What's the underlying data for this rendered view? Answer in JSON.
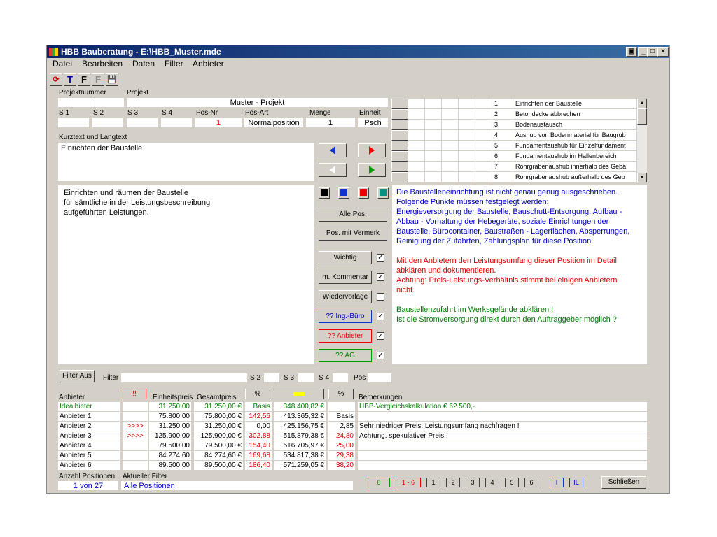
{
  "window": {
    "title": "HBB Bauberatung - E:\\HBB_Muster.mde"
  },
  "menu": [
    "Datei",
    "Bearbeiten",
    "Daten",
    "Filter",
    "Anbieter"
  ],
  "toolbar": {
    "t_label": "T",
    "f_label": "F",
    "f2_label": "F"
  },
  "form": {
    "projektnummer_label": "Projektnummer",
    "projekt_label": "Projekt",
    "projekt_value": "Muster - Projekt",
    "s1_label": "S 1",
    "s2_label": "S 2",
    "s3_label": "S 3",
    "s4_label": "S 4",
    "posnr_label": "Pos-Nr",
    "posnr_value": "1",
    "posart_label": "Pos-Art",
    "posart_value": "Normalposition",
    "menge_label": "Menge",
    "menge_value": "1",
    "einheit_label": "Einheit",
    "einheit_value": "Psch",
    "kurztext_label": "Kurztext und Langtext",
    "kurztext_value": "Einrichten der Baustelle",
    "langtext": [
      "Einrichten und räumen der Baustelle",
      "für sämtliche in der Leistungsbeschreibung",
      "aufgeführten Leistungen."
    ]
  },
  "positions": [
    {
      "nr": "1",
      "text": "Einrichten der Baustelle"
    },
    {
      "nr": "2",
      "text": "Betondecke abbrechen"
    },
    {
      "nr": "3",
      "text": "Bodenaustausch"
    },
    {
      "nr": "4",
      "text": "Aushub von Bodenmaterial für Baugrub"
    },
    {
      "nr": "5",
      "text": "Fundamentaushub für Einzelfundament"
    },
    {
      "nr": "6",
      "text": "Fundamentaushub im Hallenbereich"
    },
    {
      "nr": "7",
      "text": "Rohrgrabenaushub innerhalb des Gebä"
    },
    {
      "nr": "8",
      "text": "Rohrgrabenaushub außerhalb des Geb"
    }
  ],
  "buttons": {
    "alle_pos": "Alle Pos.",
    "pos_vermerk": "Pos. mit Vermerk",
    "wichtig": "Wichtig",
    "kommentar": "m. Kommentar",
    "wiedervorlage": "Wiedervorlage",
    "ing_buero": "?? Ing.-Büro",
    "anbieter": "?? Anbieter",
    "ag": "?? AG",
    "filter_aus": "Filter Aus",
    "schliessen": "Schließen"
  },
  "notes": {
    "blue": [
      "Die Baustelleneinrichtung ist nicht genau genug ausgeschrieben.",
      "Folgende Punkte müssen festgelegt werden:",
      "Energieversorgung der Baustelle, Bauschutt-Entsorgung, Aufbau -",
      "Abbau - Vorhaltung der Hebegeräte, soziale Einrichtungen der",
      "Baustelle, Bürocontainer, Baustraßen - Lagerflächen, Absperrungen,",
      "Reinigung der Zufahrten, Zahlungsplan für diese Position."
    ],
    "red": [
      "Mit den Anbietern den Leistungsumfang dieser Position im Detail",
      "abklären und dokumentieren.",
      "Achtung: Preis-Leistungs-Verhältnis stimmt bei einigen Anbietern",
      "nicht."
    ],
    "green": [
      "Baustellenzufahrt im Werksgelände abklären !",
      "Ist die Stromversorgung direkt durch den Auftraggeber möglich ?"
    ]
  },
  "filter": {
    "label": "Filter",
    "s2": "S 2",
    "s3": "S 3",
    "s4": "S 4",
    "pos": "Pos"
  },
  "table": {
    "headers": {
      "anbieter": "Anbieter",
      "excl": "!!",
      "einheitspreis": "Einheitspreis",
      "gesamtpreis": "Gesamtpreis",
      "pct1": "%",
      "pct2": "%",
      "bemerkungen": "Bemerkungen"
    },
    "rows": [
      {
        "name": "Idealbieter",
        "flag": "",
        "ep": "31.250,00",
        "gp": "31.250,00 €",
        "pct": "Basis",
        "sum": "348.400,82 €",
        "pct2": "",
        "note": "HBB-Vergleichskalkulation   € 62.500,-"
      },
      {
        "name": "Anbieter 1",
        "flag": "",
        "ep": "75.800,00",
        "gp": "75.800,00 €",
        "pct": "142,56",
        "sum": "413.365,32 €",
        "pct2": "Basis",
        "note": ""
      },
      {
        "name": "Anbieter 2",
        "flag": ">>>>",
        "ep": "31.250,00",
        "gp": "31.250,00 €",
        "pct": "0,00",
        "sum": "425.156,75 €",
        "pct2": "2,85",
        "note": "Sehr niedriger Preis. Leistungsumfang nachfragen !"
      },
      {
        "name": "Anbieter 3",
        "flag": ">>>>",
        "ep": "125.900,00",
        "gp": "125.900,00 €",
        "pct": "302,88",
        "sum": "515.879,38 €",
        "pct2": "24,80",
        "note": "Achtung, spekulativer Preis !"
      },
      {
        "name": "Anbieter 4",
        "flag": "",
        "ep": "79.500,00",
        "gp": "79.500,00 €",
        "pct": "154,40",
        "sum": "516.705,97 €",
        "pct2": "25,00",
        "note": ""
      },
      {
        "name": "Anbieter 5",
        "flag": "",
        "ep": "84.274,60",
        "gp": "84.274,60 €",
        "pct": "169,68",
        "sum": "534.817,38 €",
        "pct2": "29,38",
        "note": ""
      },
      {
        "name": "Anbieter 6",
        "flag": "",
        "ep": "89.500,00",
        "gp": "89.500,00 €",
        "pct": "186,40",
        "sum": "571.259,05 €",
        "pct2": "38,20",
        "note": ""
      }
    ]
  },
  "footer": {
    "anzahl_label": "Anzahl Positionen",
    "anzahl_value": "1 von 27",
    "filter_label": "Aktueller Filter",
    "filter_value": "Alle Positionen"
  },
  "pager": [
    "0",
    "1 - 6",
    "1",
    "2",
    "3",
    "4",
    "5",
    "6",
    "I",
    "IL"
  ]
}
